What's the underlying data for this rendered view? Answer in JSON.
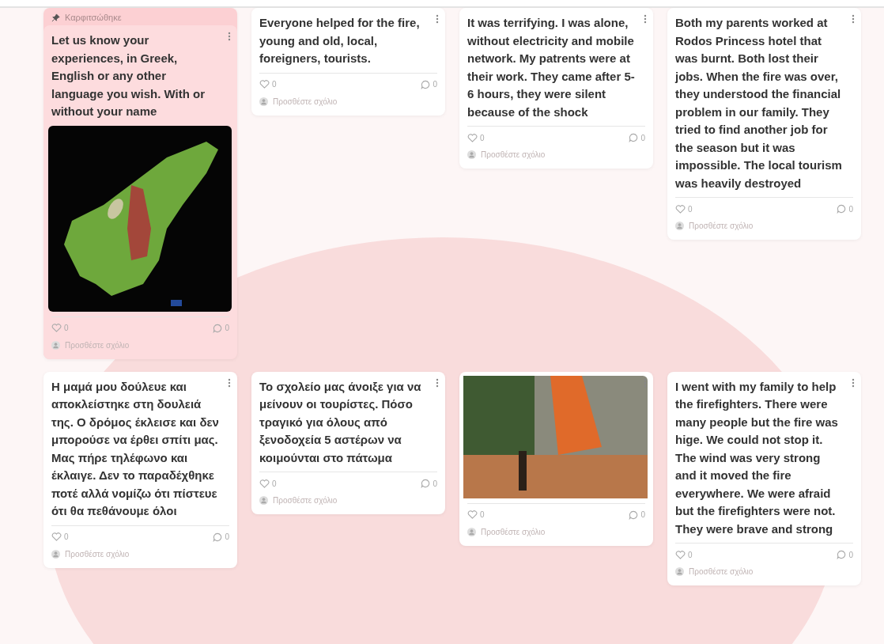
{
  "board": {
    "pinned_label": "Καρφιτσώθηκε",
    "posts": [
      {
        "kind": "map",
        "pinned": true,
        "text": "Let us know your experiences, in Greek, English or any other language you wish. With or without your name",
        "likes": "0",
        "comments": "0",
        "comment_placeholder": "Προσθέστε σχόλιο"
      },
      {
        "kind": "text",
        "pinned": false,
        "text": "Everyone helped for the fire, young and old, local, foreigners, tourists.",
        "likes": "0",
        "comments": "0",
        "comment_placeholder": "Προσθέστε σχόλιο"
      },
      {
        "kind": "text",
        "pinned": false,
        "text": "It was terrifying. I was alone, without electricity and mobile network. My patrents were at their work. They came after 5-6 hours, they were silent because of the shock",
        "likes": "0",
        "comments": "0",
        "comment_placeholder": "Προσθέστε σχόλιο"
      },
      {
        "kind": "text",
        "pinned": false,
        "text": "Both my parents worked at Rodos Princess hotel that was burnt. Both lost their jobs. When the fire was over, they understood the financial problem in our family. They tried to find another job for the season but it was impossible. The local tourism was heavily destroyed",
        "likes": "0",
        "comments": "0",
        "comment_placeholder": "Προσθέστε σχόλιο"
      },
      {
        "kind": "text",
        "pinned": false,
        "text": "Η μαμά μου δούλευε και αποκλείστηκε στη δουλειά της. Ο δρόμος έκλεισε και δεν μπορούσε να έρθει σπίτι μας. Μας πήρε τηλέφωνο και έκλαιγε. Δεν το παραδέχθηκε ποτέ αλλά νομίζω ότι πίστευε ότι θα πεθάνουμε όλοι",
        "likes": "0",
        "comments": "0",
        "comment_placeholder": "Προσθέστε σχόλιο"
      },
      {
        "kind": "text",
        "pinned": false,
        "text": "Το σχολείο μας άνοιξε για να μείνουν οι τουρίστες. Πόσο τραγικό για όλους από ξενοδοχεία 5 αστέρων να κοιμούνται στο πάτωμα",
        "likes": "0",
        "comments": "0",
        "comment_placeholder": "Προσθέστε σχόλιο"
      },
      {
        "kind": "photo",
        "pinned": false,
        "likes": "0",
        "comments": "0",
        "comment_placeholder": "Προσθέστε σχόλιο"
      },
      {
        "kind": "text",
        "pinned": false,
        "text": "I went with my family to help the firefighters. There were many people but the fire was hige. We could not stop it. The wind was very strong and it moved the fire everywhere. We were afraid but the firefighters were not. They were brave and strong",
        "likes": "0",
        "comments": "0",
        "comment_placeholder": "Προσθέστε σχόλιο"
      }
    ]
  }
}
